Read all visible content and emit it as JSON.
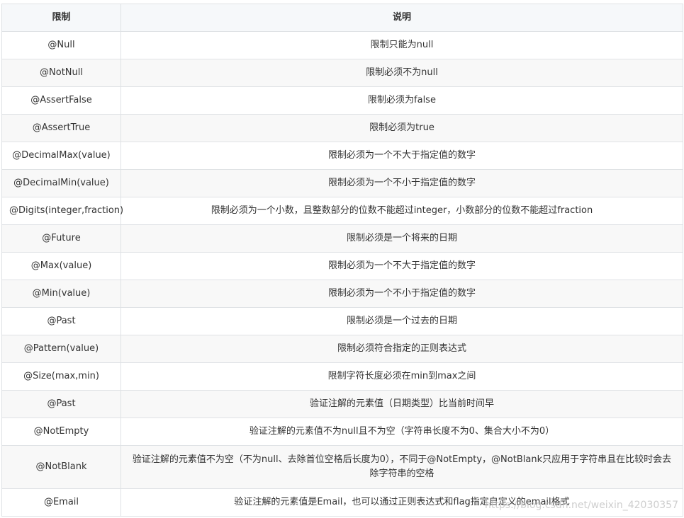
{
  "table": {
    "headers": [
      "限制",
      "说明"
    ],
    "rows": [
      {
        "annotation": "@Null",
        "description": "限制只能为null"
      },
      {
        "annotation": "@NotNull",
        "description": "限制必须不为null"
      },
      {
        "annotation": "@AssertFalse",
        "description": "限制必须为false"
      },
      {
        "annotation": "@AssertTrue",
        "description": "限制必须为true"
      },
      {
        "annotation": "@DecimalMax(value)",
        "description": "限制必须为一个不大于指定值的数字"
      },
      {
        "annotation": "@DecimalMin(value)",
        "description": "限制必须为一个不小于指定值的数字"
      },
      {
        "annotation": "@Digits(integer,fraction)",
        "description": "限制必须为一个小数，且整数部分的位数不能超过integer，小数部分的位数不能超过fraction"
      },
      {
        "annotation": "@Future",
        "description": "限制必须是一个将来的日期"
      },
      {
        "annotation": "@Max(value)",
        "description": "限制必须为一个不大于指定值的数字"
      },
      {
        "annotation": "@Min(value)",
        "description": "限制必须为一个不小于指定值的数字"
      },
      {
        "annotation": "@Past",
        "description": "限制必须是一个过去的日期"
      },
      {
        "annotation": "@Pattern(value)",
        "description": "限制必须符合指定的正则表达式"
      },
      {
        "annotation": "@Size(max,min)",
        "description": "限制字符长度必须在min到max之间"
      },
      {
        "annotation": "@Past",
        "description": "验证注解的元素值（日期类型）比当前时间早"
      },
      {
        "annotation": "@NotEmpty",
        "description": "验证注解的元素值不为null且不为空（字符串长度不为0、集合大小不为0）"
      },
      {
        "annotation": "@NotBlank",
        "description": "验证注解的元素值不为空（不为null、去除首位空格后长度为0），不同于@NotEmpty，@NotBlank只应用于字符串且在比较时会去除字符串的空格"
      },
      {
        "annotation": "@Email",
        "description": "验证注解的元素值是Email，也可以通过正则表达式和flag指定自定义的email格式"
      }
    ]
  },
  "watermark": "https://blog.csdn.net/weixin_42030357"
}
